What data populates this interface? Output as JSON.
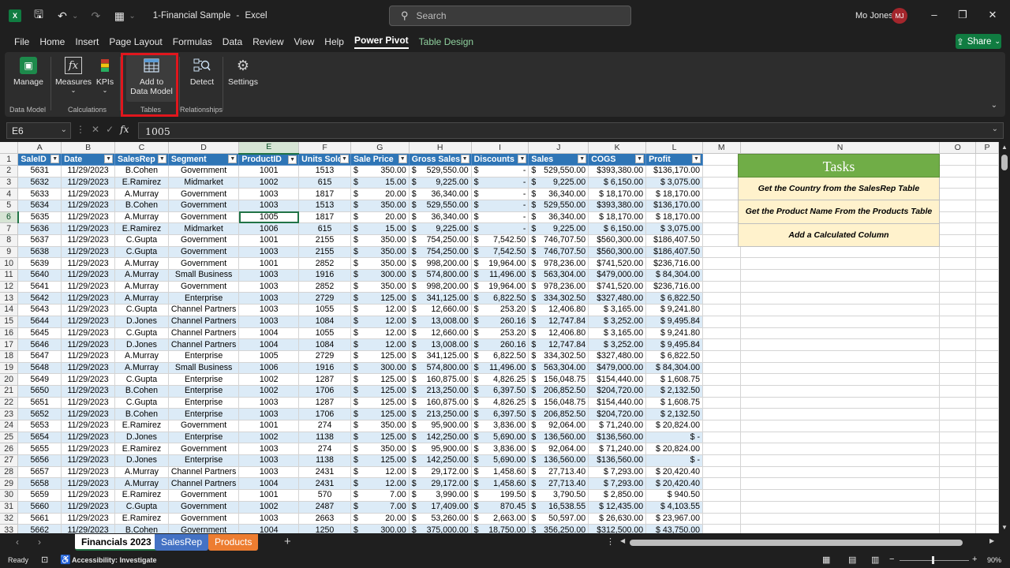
{
  "titlebar": {
    "app_icon_text": "X",
    "file_title": "1-Financial Sample",
    "separator": "-",
    "app_name": "Excel",
    "search_placeholder": "Search",
    "user_name": "Mo Jones",
    "user_initials": "MJ"
  },
  "menu": {
    "items": [
      "File",
      "Home",
      "Insert",
      "Page Layout",
      "Formulas",
      "Data",
      "Review",
      "View",
      "Help",
      "Power Pivot",
      "Table Design"
    ],
    "share_label": "Share"
  },
  "ribbon": {
    "manage": "Manage",
    "measures": "Measures",
    "kpis": "KPIs",
    "add_line1": "Add to",
    "add_line2": "Data Model",
    "detect": "Detect",
    "settings": "Settings",
    "groups": {
      "data_model": "Data Model",
      "calculations": "Calculations",
      "tables": "Tables",
      "relationships": "Relationships"
    }
  },
  "formula_bar": {
    "cell_ref": "E6",
    "value": "1005"
  },
  "columns": [
    "A",
    "B",
    "C",
    "D",
    "E",
    "F",
    "G",
    "H",
    "I",
    "J",
    "K",
    "L",
    "M",
    "N",
    "O",
    "P"
  ],
  "table_headers": [
    "SaleID",
    "Date",
    "SalesRep",
    "Segment",
    "ProductID",
    "Units Sold",
    "Sale Price",
    "Gross Sales",
    "Discounts",
    "Sales",
    "COGS",
    "Profit"
  ],
  "rows": [
    [
      "5631",
      "11/29/2023",
      "B.Cohen",
      "Government",
      "1001",
      "1513",
      "$",
      "350.00",
      "$",
      "529,550.00",
      "$",
      "-",
      "$",
      "529,550.00",
      "$393,380.00",
      "$136,170.00"
    ],
    [
      "5632",
      "11/29/2023",
      "E.Ramirez",
      "Midmarket",
      "1002",
      "615",
      "$",
      "15.00",
      "$",
      "9,225.00",
      "$",
      "-",
      "$",
      "9,225.00",
      "$   6,150.00",
      "$   3,075.00"
    ],
    [
      "5633",
      "11/29/2023",
      "A.Murray",
      "Government",
      "1003",
      "1817",
      "$",
      "20.00",
      "$",
      "36,340.00",
      "$",
      "-",
      "$",
      "36,340.00",
      "$  18,170.00",
      "$  18,170.00"
    ],
    [
      "5634",
      "11/29/2023",
      "B.Cohen",
      "Government",
      "1003",
      "1513",
      "$",
      "350.00",
      "$",
      "529,550.00",
      "$",
      "-",
      "$",
      "529,550.00",
      "$393,380.00",
      "$136,170.00"
    ],
    [
      "5635",
      "11/29/2023",
      "A.Murray",
      "Government",
      "1005",
      "1817",
      "$",
      "20.00",
      "$",
      "36,340.00",
      "$",
      "-",
      "$",
      "36,340.00",
      "$  18,170.00",
      "$  18,170.00"
    ],
    [
      "5636",
      "11/29/2023",
      "E.Ramirez",
      "Midmarket",
      "1006",
      "615",
      "$",
      "15.00",
      "$",
      "9,225.00",
      "$",
      "-",
      "$",
      "9,225.00",
      "$   6,150.00",
      "$   3,075.00"
    ],
    [
      "5637",
      "11/29/2023",
      "C.Gupta",
      "Government",
      "1001",
      "2155",
      "$",
      "350.00",
      "$",
      "754,250.00",
      "$",
      "7,542.50",
      "$",
      "746,707.50",
      "$560,300.00",
      "$186,407.50"
    ],
    [
      "5638",
      "11/29/2023",
      "C.Gupta",
      "Government",
      "1003",
      "2155",
      "$",
      "350.00",
      "$",
      "754,250.00",
      "$",
      "7,542.50",
      "$",
      "746,707.50",
      "$560,300.00",
      "$186,407.50"
    ],
    [
      "5639",
      "11/29/2023",
      "A.Murray",
      "Government",
      "1001",
      "2852",
      "$",
      "350.00",
      "$",
      "998,200.00",
      "$",
      "19,964.00",
      "$",
      "978,236.00",
      "$741,520.00",
      "$236,716.00"
    ],
    [
      "5640",
      "11/29/2023",
      "A.Murray",
      "Small Business",
      "1003",
      "1916",
      "$",
      "300.00",
      "$",
      "574,800.00",
      "$",
      "11,496.00",
      "$",
      "563,304.00",
      "$479,000.00",
      "$  84,304.00"
    ],
    [
      "5641",
      "11/29/2023",
      "A.Murray",
      "Government",
      "1003",
      "2852",
      "$",
      "350.00",
      "$",
      "998,200.00",
      "$",
      "19,964.00",
      "$",
      "978,236.00",
      "$741,520.00",
      "$236,716.00"
    ],
    [
      "5642",
      "11/29/2023",
      "A.Murray",
      "Enterprise",
      "1003",
      "2729",
      "$",
      "125.00",
      "$",
      "341,125.00",
      "$",
      "6,822.50",
      "$",
      "334,302.50",
      "$327,480.00",
      "$   6,822.50"
    ],
    [
      "5643",
      "11/29/2023",
      "C.Gupta",
      "Channel Partners",
      "1003",
      "1055",
      "$",
      "12.00",
      "$",
      "12,660.00",
      "$",
      "253.20",
      "$",
      "12,406.80",
      "$   3,165.00",
      "$   9,241.80"
    ],
    [
      "5644",
      "11/29/2023",
      "D.Jones",
      "Channel Partners",
      "1003",
      "1084",
      "$",
      "12.00",
      "$",
      "13,008.00",
      "$",
      "260.16",
      "$",
      "12,747.84",
      "$   3,252.00",
      "$   9,495.84"
    ],
    [
      "5645",
      "11/29/2023",
      "C.Gupta",
      "Channel Partners",
      "1004",
      "1055",
      "$",
      "12.00",
      "$",
      "12,660.00",
      "$",
      "253.20",
      "$",
      "12,406.80",
      "$   3,165.00",
      "$   9,241.80"
    ],
    [
      "5646",
      "11/29/2023",
      "D.Jones",
      "Channel Partners",
      "1004",
      "1084",
      "$",
      "12.00",
      "$",
      "13,008.00",
      "$",
      "260.16",
      "$",
      "12,747.84",
      "$   3,252.00",
      "$   9,495.84"
    ],
    [
      "5647",
      "11/29/2023",
      "A.Murray",
      "Enterprise",
      "1005",
      "2729",
      "$",
      "125.00",
      "$",
      "341,125.00",
      "$",
      "6,822.50",
      "$",
      "334,302.50",
      "$327,480.00",
      "$   6,822.50"
    ],
    [
      "5648",
      "11/29/2023",
      "A.Murray",
      "Small Business",
      "1006",
      "1916",
      "$",
      "300.00",
      "$",
      "574,800.00",
      "$",
      "11,496.00",
      "$",
      "563,304.00",
      "$479,000.00",
      "$  84,304.00"
    ],
    [
      "5649",
      "11/29/2023",
      "C.Gupta",
      "Enterprise",
      "1002",
      "1287",
      "$",
      "125.00",
      "$",
      "160,875.00",
      "$",
      "4,826.25",
      "$",
      "156,048.75",
      "$154,440.00",
      "$   1,608.75"
    ],
    [
      "5650",
      "11/29/2023",
      "B.Cohen",
      "Enterprise",
      "1002",
      "1706",
      "$",
      "125.00",
      "$",
      "213,250.00",
      "$",
      "6,397.50",
      "$",
      "206,852.50",
      "$204,720.00",
      "$   2,132.50"
    ],
    [
      "5651",
      "11/29/2023",
      "C.Gupta",
      "Enterprise",
      "1003",
      "1287",
      "$",
      "125.00",
      "$",
      "160,875.00",
      "$",
      "4,826.25",
      "$",
      "156,048.75",
      "$154,440.00",
      "$   1,608.75"
    ],
    [
      "5652",
      "11/29/2023",
      "B.Cohen",
      "Enterprise",
      "1003",
      "1706",
      "$",
      "125.00",
      "$",
      "213,250.00",
      "$",
      "6,397.50",
      "$",
      "206,852.50",
      "$204,720.00",
      "$   2,132.50"
    ],
    [
      "5653",
      "11/29/2023",
      "E.Ramirez",
      "Government",
      "1001",
      "274",
      "$",
      "350.00",
      "$",
      "95,900.00",
      "$",
      "3,836.00",
      "$",
      "92,064.00",
      "$  71,240.00",
      "$  20,824.00"
    ],
    [
      "5654",
      "11/29/2023",
      "D.Jones",
      "Enterprise",
      "1002",
      "1138",
      "$",
      "125.00",
      "$",
      "142,250.00",
      "$",
      "5,690.00",
      "$",
      "136,560.00",
      "$136,560.00",
      "$          -"
    ],
    [
      "5655",
      "11/29/2023",
      "E.Ramirez",
      "Government",
      "1003",
      "274",
      "$",
      "350.00",
      "$",
      "95,900.00",
      "$",
      "3,836.00",
      "$",
      "92,064.00",
      "$  71,240.00",
      "$  20,824.00"
    ],
    [
      "5656",
      "11/29/2023",
      "D.Jones",
      "Enterprise",
      "1003",
      "1138",
      "$",
      "125.00",
      "$",
      "142,250.00",
      "$",
      "5,690.00",
      "$",
      "136,560.00",
      "$136,560.00",
      "$          -"
    ],
    [
      "5657",
      "11/29/2023",
      "A.Murray",
      "Channel Partners",
      "1003",
      "2431",
      "$",
      "12.00",
      "$",
      "29,172.00",
      "$",
      "1,458.60",
      "$",
      "27,713.40",
      "$   7,293.00",
      "$  20,420.40"
    ],
    [
      "5658",
      "11/29/2023",
      "A.Murray",
      "Channel Partners",
      "1004",
      "2431",
      "$",
      "12.00",
      "$",
      "29,172.00",
      "$",
      "1,458.60",
      "$",
      "27,713.40",
      "$   7,293.00",
      "$  20,420.40"
    ],
    [
      "5659",
      "11/29/2023",
      "E.Ramirez",
      "Government",
      "1001",
      "570",
      "$",
      "7.00",
      "$",
      "3,990.00",
      "$",
      "199.50",
      "$",
      "3,790.50",
      "$   2,850.00",
      "$     940.50"
    ],
    [
      "5660",
      "11/29/2023",
      "C.Gupta",
      "Government",
      "1002",
      "2487",
      "$",
      "7.00",
      "$",
      "17,409.00",
      "$",
      "870.45",
      "$",
      "16,538.55",
      "$  12,435.00",
      "$   4,103.55"
    ],
    [
      "5661",
      "11/29/2023",
      "E.Ramirez",
      "Government",
      "1003",
      "2663",
      "$",
      "20.00",
      "$",
      "53,260.00",
      "$",
      "2,663.00",
      "$",
      "50,597.00",
      "$  26,630.00",
      "$  23,967.00"
    ],
    [
      "5662",
      "11/29/2023",
      "B.Cohen",
      "Government",
      "1004",
      "1250",
      "$",
      "300.00",
      "$",
      "375,000.00",
      "$",
      "18,750.00",
      "$",
      "356,250.00",
      "$312,500.00",
      "$  43,750.00"
    ]
  ],
  "tasks": {
    "title": "Tasks",
    "items": [
      "Get the Country from the SalesRep Table",
      "Get the Product Name From the Products Table",
      "Add a Calculated Column"
    ]
  },
  "sheets": {
    "active": "Financials 2023",
    "second": "SalesRep",
    "third": "Products",
    "add": "+"
  },
  "status": {
    "ready": "Ready",
    "accessibility": "Accessibility: Investigate",
    "zoom": "90%"
  },
  "colors": {
    "table_header": "#2e75b6",
    "band": "#dcebf7",
    "tasks_title": "#70ad47",
    "tasks_row": "#fff2cc",
    "highlight": "#e0161d",
    "share": "#107c41"
  }
}
